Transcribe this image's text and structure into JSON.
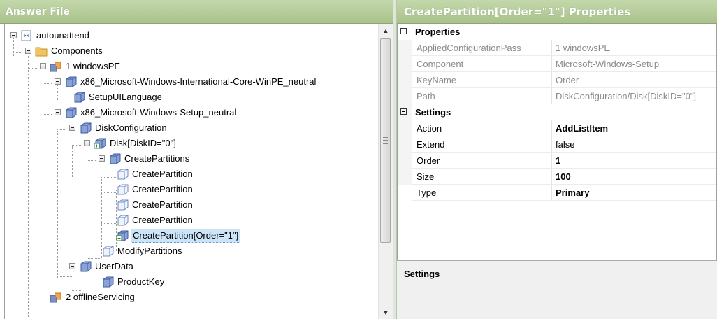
{
  "left_panel": {
    "title": "Answer File"
  },
  "right_panel": {
    "title": "CreatePartition[Order=\"1\"] Properties"
  },
  "tree": [
    {
      "label": "autounattend",
      "icon": "answer-file-icon",
      "expanded": true
    },
    {
      "label": "Components",
      "icon": "folder-icon",
      "expanded": true
    },
    {
      "label": "1 windowsPE",
      "icon": "pass-icon",
      "expanded": true
    },
    {
      "label": "x86_Microsoft-Windows-International-Core-WinPE_neutral",
      "icon": "component-icon",
      "expanded": true
    },
    {
      "label": "SetupUILanguage",
      "icon": "setting-icon"
    },
    {
      "label": "x86_Microsoft-Windows-Setup_neutral",
      "icon": "component-icon",
      "expanded": true
    },
    {
      "label": "DiskConfiguration",
      "icon": "setting-icon",
      "expanded": true
    },
    {
      "label": "Disk[DiskID=\"0\"]",
      "icon": "list-item-icon",
      "expanded": true
    },
    {
      "label": "CreatePartitions",
      "icon": "setting-icon",
      "expanded": true
    },
    {
      "label": "CreatePartition",
      "icon": "setting-empty-icon"
    },
    {
      "label": "CreatePartition",
      "icon": "setting-empty-icon"
    },
    {
      "label": "CreatePartition",
      "icon": "setting-empty-icon"
    },
    {
      "label": "CreatePartition",
      "icon": "setting-empty-icon"
    },
    {
      "label": "CreatePartition[Order=\"1\"]",
      "icon": "list-item-icon",
      "selected": true
    },
    {
      "label": "ModifyPartitions",
      "icon": "setting-empty-icon"
    },
    {
      "label": "UserData",
      "icon": "setting-icon",
      "expanded": true
    },
    {
      "label": "ProductKey",
      "icon": "setting-icon"
    },
    {
      "label": "2 offlineServicing",
      "icon": "pass-icon"
    }
  ],
  "properties": {
    "group_label": "Properties",
    "rows": [
      {
        "name": "AppliedConfigurationPass",
        "value": "1 windowsPE"
      },
      {
        "name": "Component",
        "value": "Microsoft-Windows-Setup"
      },
      {
        "name": "KeyName",
        "value": "Order"
      },
      {
        "name": "Path",
        "value": "DiskConfiguration/Disk[DiskID=\"0\"]"
      }
    ]
  },
  "settings": {
    "group_label": "Settings",
    "rows": [
      {
        "name": "Action",
        "value": "AddListItem"
      },
      {
        "name": "Extend",
        "value": "false"
      },
      {
        "name": "Order",
        "value": "1"
      },
      {
        "name": "Size",
        "value": "100"
      },
      {
        "name": "Type",
        "value": "Primary"
      }
    ]
  },
  "help": {
    "title": "Settings"
  },
  "colors": {
    "title_bar": "#b4cc98",
    "selection": "#cce4f7",
    "gray_text": "#8a8a8a"
  }
}
